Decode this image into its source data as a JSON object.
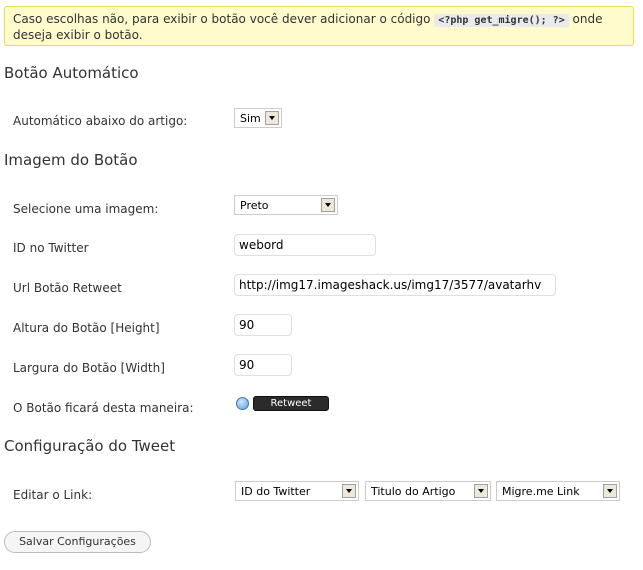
{
  "notice": {
    "text_before": "Caso escolhas não, para exibir o botão você dever adicionar o código ",
    "code": "<?php get_migre(); ?>",
    "text_after": " onde deseja exibir o botão."
  },
  "section_auto": {
    "title": "Botão Automático",
    "auto_label": "Automático abaixo do artigo:",
    "auto_value": "Sim"
  },
  "section_image": {
    "title": "Imagem do Botão",
    "select_label": "Selecione uma imagem:",
    "select_value": "Preto",
    "twitter_label": "ID no Twitter",
    "twitter_value": "webord",
    "url_label": "Url Botão Retweet",
    "url_value": "http://img17.imageshack.us/img17/3577/avatarhv",
    "height_label": "Altura do Botão [Height]",
    "height_value": "90",
    "width_label": "Largura do Botão [Width]",
    "width_value": "90",
    "preview_label": "O Botão ficará desta maneira:",
    "preview_button": "Retweet"
  },
  "section_tweet": {
    "title": "Configuração do Tweet",
    "link_label": "Editar o Link:",
    "link_select_1": "ID do Twitter",
    "link_select_2": "Titulo do Artigo",
    "link_select_3": "Migre.me Link"
  },
  "save_button": "Salvar Configurações",
  "colors": {
    "notice_bg": "#fffbcc",
    "notice_border": "#e6db55",
    "retweet_button_bg": "#2b2b2b"
  }
}
